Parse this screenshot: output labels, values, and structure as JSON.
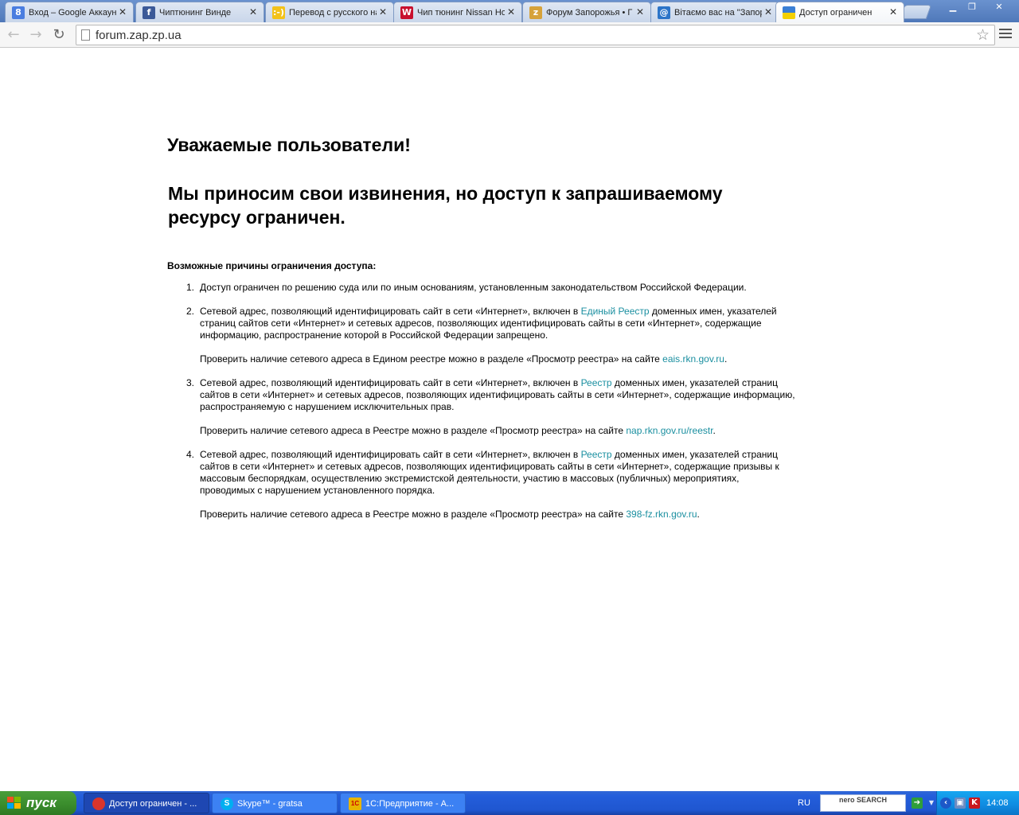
{
  "browser": {
    "tabs": [
      {
        "title": "Вход – Google Аккаунт",
        "favicon": "google-icon",
        "favicon_letter": "8",
        "favicon_color": "#4a7de0"
      },
      {
        "title": "Чиптюнинг Винде",
        "favicon": "facebook-icon",
        "favicon_letter": "f",
        "favicon_color": "#3b5998"
      },
      {
        "title": "Перевод с русского на",
        "favicon": "smiley-icon",
        "favicon_letter": ":-)",
        "favicon_color": "#f3c21a"
      },
      {
        "title": "Чип тюнинг Nissan Ho",
        "favicon": "wiki-icon",
        "favicon_letter": "W",
        "favicon_color": "#c8102e"
      },
      {
        "title": "Форум Запорожья • Г",
        "favicon": "forum-icon",
        "favicon_letter": "z",
        "favicon_color": "#d6a23a"
      },
      {
        "title": "Вітаємо вас на \"Запор",
        "favicon": "globe-icon",
        "favicon_letter": "@",
        "favicon_color": "#2c74c8"
      },
      {
        "title": "Доступ ограничен",
        "favicon": "flag-icon",
        "favicon_letter": "",
        "favicon_color": "#f4d000",
        "active": true
      }
    ],
    "close_glyph": "✕",
    "address_url": "forum.zap.zp.ua"
  },
  "page": {
    "greeting": "Уважаемые пользователи!",
    "apology": "Мы приносим свои извинения, но доступ к запрашиваемому ресурсу ограничен.",
    "reasons_title": "Возможные причины ограничения доступа:",
    "reasons": [
      {
        "num": "1.",
        "text": "Доступ ограничен  по решению суда или по иным основаниям, установленным законодательством Российской Федерации."
      },
      {
        "num": "2.",
        "before": "Сетевой адрес, позволяющий идентифицировать сайт в сети «Интернет», включен в ",
        "link": "Единый Реестр",
        "after": " доменных имен, указателей страниц сайтов сети «Интернет» и сетевых адресов, позволяющих идентифицировать сайты в сети «Интернет», содержащие информацию, распространение которой в Российской Федерации запрещено.",
        "check_before": "Проверить наличие сетевого адреса в Едином реестре можно в разделе «Просмотр реестра» на сайте ",
        "check_link": "eais.rkn.gov.ru",
        "check_after": "."
      },
      {
        "num": "3.",
        "before": "Сетевой адрес, позволяющий идентифицировать сайт в сети «Интернет», включен в ",
        "link": "Реестр",
        "after": " доменных имен, указателей страниц сайтов в сети «Интернет» и сетевых адресов, позволяющих идентифицировать сайты в сети «Интернет», содержащие информацию, распространяемую с нарушением исключительных прав.",
        "check_before": "Проверить наличие сетевого адреса в Реестре можно в разделе «Просмотр реестра» на сайте ",
        "check_link": "nap.rkn.gov.ru/reestr",
        "check_after": "."
      },
      {
        "num": "4.",
        "before": "Сетевой адрес, позволяющий идентифицировать сайт в сети «Интернет», включен в ",
        "link": "Реестр",
        "after": " доменных имен, указателей страниц сайтов в сети «Интернет» и сетевых адресов, позволяющих идентифицировать сайты в сети «Интернет», содержащие призывы к массовым беспорядкам, осуществлению экстремистской деятельности, участию в массовых (публичных) мероприятиях, проводимых с нарушением установленного порядка.",
        "check_before": "Проверить наличие сетевого адреса в Реестре можно в разделе «Просмотр реестра» на сайте ",
        "check_link": "398-fz.rkn.gov.ru",
        "check_after": "."
      }
    ],
    "link_color": "#1a8fa0"
  },
  "taskbar": {
    "start_label": "пуск",
    "tasks": [
      {
        "label": "Доступ ограничен - ...",
        "icon": "chrome-icon",
        "icon_letter": "",
        "icon_color": "#d9352b",
        "active": true
      },
      {
        "label": "Skype™ - gratsa",
        "icon": "skype-icon",
        "icon_letter": "S",
        "icon_color": "#00aff0",
        "active": false
      },
      {
        "label": "1С:Предприятие - А...",
        "icon": "1c-icon",
        "icon_letter": "1С",
        "icon_color": "#e8b400",
        "active": false
      }
    ],
    "language": "RU",
    "search_widget": "nero SEARCH",
    "clock": "14:08"
  }
}
